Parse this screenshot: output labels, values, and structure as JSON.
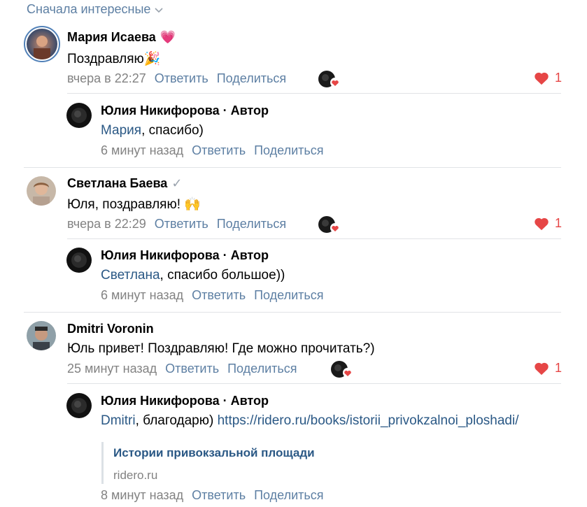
{
  "sort": {
    "label": "Сначала интересные"
  },
  "colors": {
    "accent": "#5d7fa3",
    "link": "#2a5885",
    "like": "#e64646"
  },
  "comments": [
    {
      "author": "Мария Исаева",
      "author_badge": "💗",
      "text": "Поздравляю🎉",
      "time": "вчера в 22:27",
      "reply": "Ответить",
      "share": "Поделиться",
      "likes": "1",
      "reply_item": {
        "author": "Юлия Никифорова · Автор",
        "mention": "Мария",
        "text": ", спасибо)",
        "time": "6 минут назад",
        "reply": "Ответить",
        "share": "Поделиться"
      }
    },
    {
      "author": "Светлана Баева",
      "author_badge": "✓",
      "text": "Юля, поздравляю! 🙌",
      "time": "вчера в 22:29",
      "reply": "Ответить",
      "share": "Поделиться",
      "likes": "1",
      "reply_item": {
        "author": "Юлия Никифорова · Автор",
        "mention": "Светлана",
        "text": ", спасибо большое))",
        "time": "6 минут назад",
        "reply": "Ответить",
        "share": "Поделиться"
      }
    },
    {
      "author": "Dmitri Voronin",
      "text": "Юль привет! Поздравляю! Где можно прочитать?)",
      "time": "25 минут назад",
      "reply": "Ответить",
      "share": "Поделиться",
      "likes": "1",
      "reply_item": {
        "author": "Юлия Никифорова · Автор",
        "mention": "Dmitri",
        "text": ", благодарю) ",
        "link": "https://ridero.ru/books/istorii_privokzalnoi_ploshadi/",
        "snippet_title": "Истории привокзальной площади",
        "snippet_domain": "ridero.ru",
        "time": "8 минут назад",
        "reply": "Ответить",
        "share": "Поделиться"
      }
    }
  ]
}
